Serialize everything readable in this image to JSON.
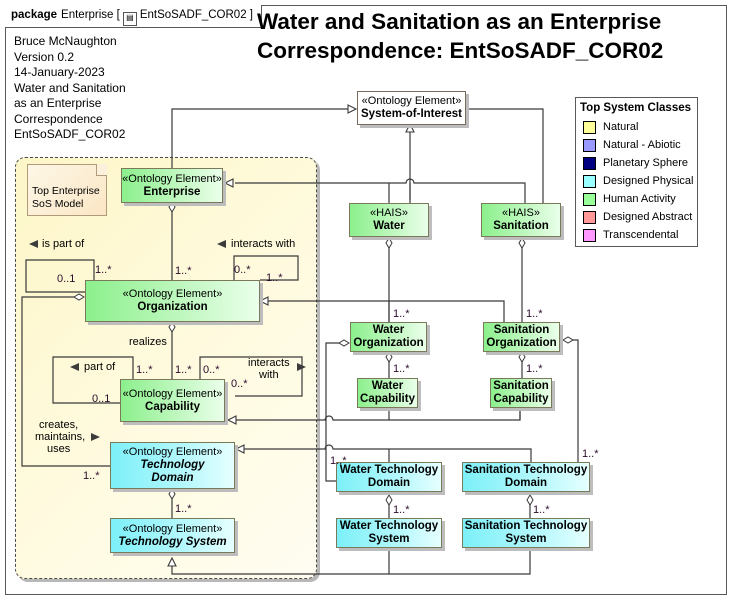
{
  "frame": {
    "kind": "package",
    "name": "Enterprise",
    "diagram": "EntSoSADF_COR02",
    "diagram_icon": "class-diagram-icon"
  },
  "title": {
    "line1": "Water and Sanitation as an Enterprise",
    "line2": "Correspondence:  EntSoSADF_COR02"
  },
  "meta": [
    "Bruce McNaughton",
    "Version 0.2",
    "14-January-2023",
    "Water and Sanitation",
    "as an Enterprise",
    "Correspondence",
    "EntSoSADF_COR02"
  ],
  "note": {
    "line1": "Top Enterprise",
    "line2": "SoS Model"
  },
  "classes": {
    "soi": {
      "stereotype": "«Ontology Element»",
      "name": "System-of-Interest"
    },
    "enterprise": {
      "stereotype": "«Ontology Element»",
      "name": "Enterprise"
    },
    "organization": {
      "stereotype": "«Ontology Element»",
      "name": "Organization"
    },
    "capability": {
      "stereotype": "«Ontology Element»",
      "name": "Capability"
    },
    "tech_domain": {
      "stereotype": "«Ontology Element»",
      "name1": "Technology",
      "name2": "Domain"
    },
    "tech_system": {
      "stereotype": "«Ontology Element»",
      "name": "Technology System"
    },
    "water": {
      "stereotype": "«HAIS»",
      "name": "Water"
    },
    "sanitation": {
      "stereotype": "«HAIS»",
      "name": "Sanitation"
    },
    "water_org": {
      "name1": "Water",
      "name2": "Organization"
    },
    "san_org": {
      "name1": "Sanitation",
      "name2": "Organization"
    },
    "water_cap": {
      "name1": "Water",
      "name2": "Capability"
    },
    "san_cap": {
      "name1": "Sanitation",
      "name2": "Capability"
    },
    "water_td": {
      "name1": "Water Technology",
      "name2": "Domain"
    },
    "san_td": {
      "name1": "Sanitation Technology",
      "name2": "Domain"
    },
    "water_ts": {
      "name1": "Water Technology",
      "name2": "System"
    },
    "san_ts": {
      "name1": "Sanitation Technology",
      "name2": "System"
    }
  },
  "labels": {
    "is_part_of": "is part of",
    "interacts_with_top": "interacts with",
    "realizes": "realizes",
    "part_of": "part of",
    "interacts_1": "interacts",
    "interacts_2": "with",
    "creates_1": "creates,",
    "creates_2": "maintains,",
    "creates_3": "uses"
  },
  "multiplicities": {
    "org_self_a": "0..1",
    "org_self_b": "1..*",
    "ent_org": "1..*",
    "org_int_a": "0..*",
    "org_int_b": "1..*",
    "cap_self_a": "1..*",
    "cap_self_b": "0..1",
    "org_cap": "1..*",
    "cap_int_a": "0..*",
    "cap_int_b": "0..*",
    "org_td": "1..*",
    "td_ts": "1..*",
    "water_worg": "1..*",
    "worg_wcap": "1..*",
    "san_sorg": "1..*",
    "sorg_scap": "1..*",
    "worg_wtd": "1..*",
    "sorg_std": "1..*",
    "wtd_wts": "1..*",
    "std_sts": "1..*"
  },
  "legend": {
    "title": "Top System Classes",
    "items": [
      {
        "label": "Natural",
        "color": "#ffff99"
      },
      {
        "label": "Natural - Abiotic",
        "color": "#9999ff"
      },
      {
        "label": "Planetary Sphere",
        "color": "#000080"
      },
      {
        "label": "Designed Physical",
        "color": "#99ffff"
      },
      {
        "label": "Human Activity",
        "color": "#99ff99"
      },
      {
        "label": "Designed Abstract",
        "color": "#ff9999"
      },
      {
        "label": "Transcendental",
        "color": "#ff99ff"
      }
    ]
  }
}
